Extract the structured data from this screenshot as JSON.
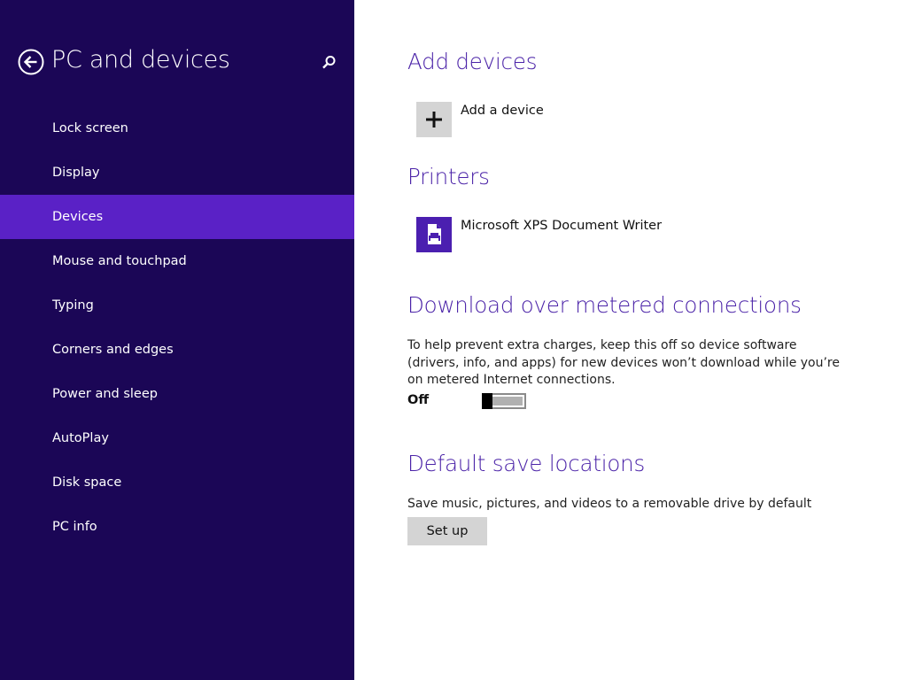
{
  "sidebar": {
    "title": "PC and devices",
    "back_icon": "back-arrow-icon",
    "search_icon": "search-icon",
    "items": [
      {
        "label": "Lock screen",
        "selected": false
      },
      {
        "label": "Display",
        "selected": false
      },
      {
        "label": "Devices",
        "selected": true
      },
      {
        "label": "Mouse and touchpad",
        "selected": false
      },
      {
        "label": "Typing",
        "selected": false
      },
      {
        "label": "Corners and edges",
        "selected": false
      },
      {
        "label": "Power and sleep",
        "selected": false
      },
      {
        "label": "AutoPlay",
        "selected": false
      },
      {
        "label": "Disk space",
        "selected": false
      },
      {
        "label": "PC info",
        "selected": false
      }
    ]
  },
  "main": {
    "add_devices": {
      "title": "Add devices",
      "add_label": "Add a device",
      "icon": "plus-icon"
    },
    "printers": {
      "title": "Printers",
      "items": [
        {
          "label": "Microsoft XPS Document Writer",
          "icon": "printer-icon"
        }
      ]
    },
    "metered": {
      "title": "Download over metered connections",
      "description": "To help prevent extra charges, keep this off so device software (drivers, info, and apps) for new devices won’t download while you’re on metered Internet connections.",
      "toggle_label": "Off",
      "toggle_on": false
    },
    "save_locations": {
      "title": "Default save locations",
      "description": "Save music, pictures, and videos to a removable drive by default",
      "button_label": "Set up"
    }
  },
  "colors": {
    "sidebar_bg": "#1b0656",
    "selected_bg": "#5a21c6",
    "accent": "#4b23a8",
    "button_bg": "#d4d4d4"
  }
}
